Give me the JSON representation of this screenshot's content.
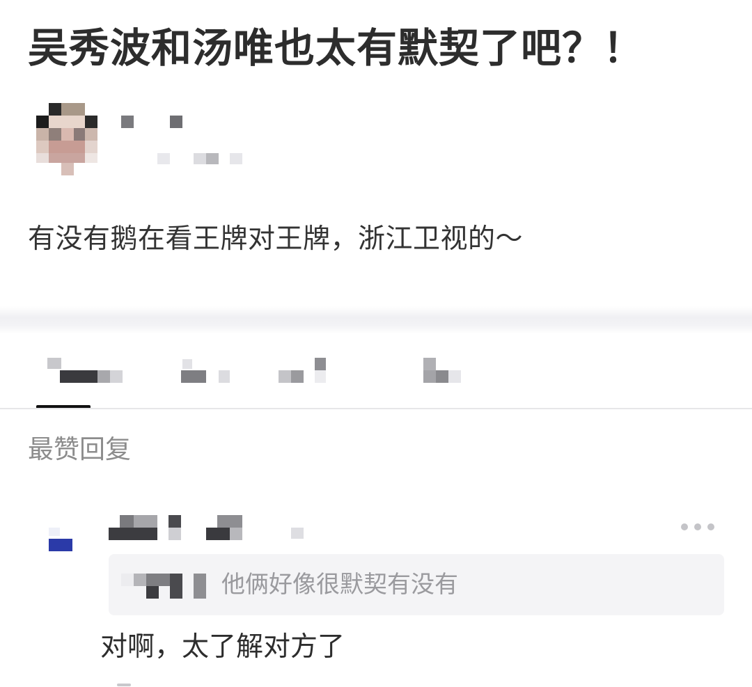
{
  "post": {
    "title": "吴秀波和汤唯也太有默契了吧？！",
    "body": "有没有鹅在看王牌对王牌，浙江卫视的～"
  },
  "section": {
    "label": "最赞回复"
  },
  "comment": {
    "quote_text": "他俩好像很默契有没有",
    "text": "对啊，太了解对方了"
  },
  "colors": {
    "title": "#2d2d2d",
    "muted": "#8c8c8c",
    "quote_bg": "#f4f4f6",
    "tab_indicator": "#111111"
  },
  "icons": {
    "more": "more-horizontal-icon"
  }
}
